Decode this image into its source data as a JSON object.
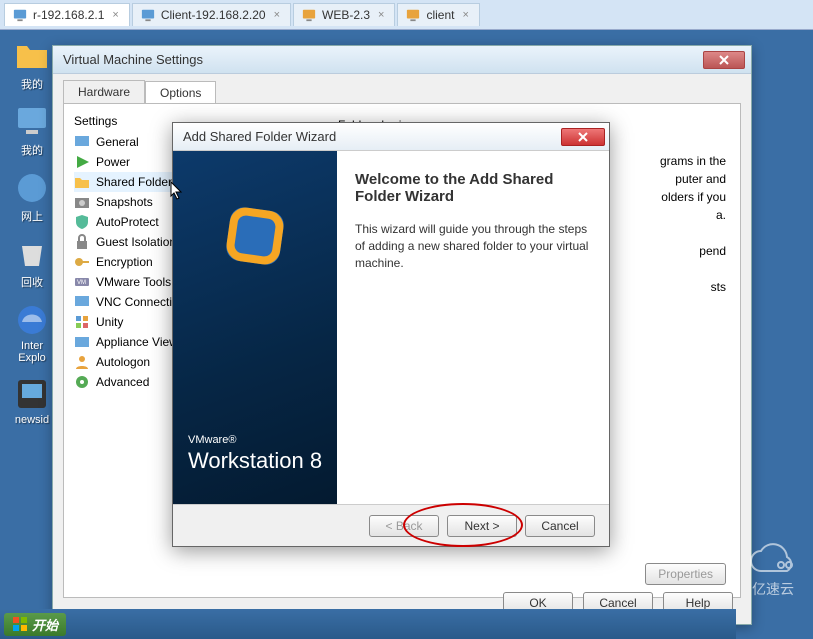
{
  "tabs": [
    {
      "label": "r-192.168.2.1",
      "icon": "vm",
      "close": "×"
    },
    {
      "label": "Client-192.168.2.20",
      "icon": "vm",
      "close": "×"
    },
    {
      "label": "WEB-2.3",
      "icon": "vm",
      "close": "×"
    },
    {
      "label": "client",
      "icon": "vm",
      "close": "×"
    }
  ],
  "desktop_icons": [
    {
      "label": "我的"
    },
    {
      "label": "我的"
    },
    {
      "label": "网上"
    },
    {
      "label": "回收"
    },
    {
      "label": "Inter\nExplo"
    },
    {
      "label": "newsid"
    }
  ],
  "start_label": "开始",
  "watermark": "亿速云",
  "settings_window": {
    "title": "Virtual Machine Settings",
    "tabs": {
      "hardware": "Hardware",
      "options": "Options"
    },
    "section": "Settings",
    "items": [
      "General",
      "Power",
      "Shared Folders",
      "Snapshots",
      "AutoProtect",
      "Guest Isolation",
      "Encryption",
      "VMware Tools",
      "VNC Connections",
      "Unity",
      "Appliance View",
      "Autologon",
      "Advanced"
    ],
    "right_title": "Folder sharing",
    "right_text_1": "grams in the",
    "right_text_2": "puter and",
    "right_text_3": "olders if you",
    "right_text_4": "a.",
    "right_text_5": "pend",
    "right_text_6": "sts",
    "buttons": {
      "properties": "Properties"
    },
    "footer": {
      "ok": "OK",
      "cancel": "Cancel",
      "help": "Help"
    }
  },
  "wizard": {
    "title": "Add Shared Folder Wizard",
    "heading": "Welcome to the Add Shared Folder Wizard",
    "body": "This wizard will guide you through the steps of adding a new shared folder to your virtual machine.",
    "brand_small": "VMware®",
    "brand_big": "Workstation 8",
    "buttons": {
      "back": "< Back",
      "next": "Next >",
      "cancel": "Cancel"
    }
  }
}
